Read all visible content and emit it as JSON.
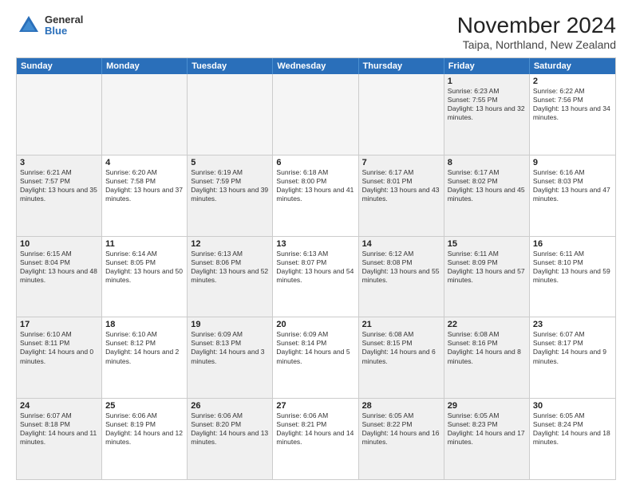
{
  "logo": {
    "general": "General",
    "blue": "Blue"
  },
  "header": {
    "month": "November 2024",
    "location": "Taipa, Northland, New Zealand"
  },
  "weekdays": [
    "Sunday",
    "Monday",
    "Tuesday",
    "Wednesday",
    "Thursday",
    "Friday",
    "Saturday"
  ],
  "rows": [
    [
      {
        "day": "",
        "info": "",
        "empty": true
      },
      {
        "day": "",
        "info": "",
        "empty": true
      },
      {
        "day": "",
        "info": "",
        "empty": true
      },
      {
        "day": "",
        "info": "",
        "empty": true
      },
      {
        "day": "",
        "info": "",
        "empty": true
      },
      {
        "day": "1",
        "info": "Sunrise: 6:23 AM\nSunset: 7:55 PM\nDaylight: 13 hours and 32 minutes.",
        "shaded": true
      },
      {
        "day": "2",
        "info": "Sunrise: 6:22 AM\nSunset: 7:56 PM\nDaylight: 13 hours and 34 minutes.",
        "shaded": false
      }
    ],
    [
      {
        "day": "3",
        "info": "Sunrise: 6:21 AM\nSunset: 7:57 PM\nDaylight: 13 hours and 35 minutes.",
        "shaded": true
      },
      {
        "day": "4",
        "info": "Sunrise: 6:20 AM\nSunset: 7:58 PM\nDaylight: 13 hours and 37 minutes.",
        "shaded": false
      },
      {
        "day": "5",
        "info": "Sunrise: 6:19 AM\nSunset: 7:59 PM\nDaylight: 13 hours and 39 minutes.",
        "shaded": true
      },
      {
        "day": "6",
        "info": "Sunrise: 6:18 AM\nSunset: 8:00 PM\nDaylight: 13 hours and 41 minutes.",
        "shaded": false
      },
      {
        "day": "7",
        "info": "Sunrise: 6:17 AM\nSunset: 8:01 PM\nDaylight: 13 hours and 43 minutes.",
        "shaded": true
      },
      {
        "day": "8",
        "info": "Sunrise: 6:17 AM\nSunset: 8:02 PM\nDaylight: 13 hours and 45 minutes.",
        "shaded": true
      },
      {
        "day": "9",
        "info": "Sunrise: 6:16 AM\nSunset: 8:03 PM\nDaylight: 13 hours and 47 minutes.",
        "shaded": false
      }
    ],
    [
      {
        "day": "10",
        "info": "Sunrise: 6:15 AM\nSunset: 8:04 PM\nDaylight: 13 hours and 48 minutes.",
        "shaded": true
      },
      {
        "day": "11",
        "info": "Sunrise: 6:14 AM\nSunset: 8:05 PM\nDaylight: 13 hours and 50 minutes.",
        "shaded": false
      },
      {
        "day": "12",
        "info": "Sunrise: 6:13 AM\nSunset: 8:06 PM\nDaylight: 13 hours and 52 minutes.",
        "shaded": true
      },
      {
        "day": "13",
        "info": "Sunrise: 6:13 AM\nSunset: 8:07 PM\nDaylight: 13 hours and 54 minutes.",
        "shaded": false
      },
      {
        "day": "14",
        "info": "Sunrise: 6:12 AM\nSunset: 8:08 PM\nDaylight: 13 hours and 55 minutes.",
        "shaded": true
      },
      {
        "day": "15",
        "info": "Sunrise: 6:11 AM\nSunset: 8:09 PM\nDaylight: 13 hours and 57 minutes.",
        "shaded": true
      },
      {
        "day": "16",
        "info": "Sunrise: 6:11 AM\nSunset: 8:10 PM\nDaylight: 13 hours and 59 minutes.",
        "shaded": false
      }
    ],
    [
      {
        "day": "17",
        "info": "Sunrise: 6:10 AM\nSunset: 8:11 PM\nDaylight: 14 hours and 0 minutes.",
        "shaded": true
      },
      {
        "day": "18",
        "info": "Sunrise: 6:10 AM\nSunset: 8:12 PM\nDaylight: 14 hours and 2 minutes.",
        "shaded": false
      },
      {
        "day": "19",
        "info": "Sunrise: 6:09 AM\nSunset: 8:13 PM\nDaylight: 14 hours and 3 minutes.",
        "shaded": true
      },
      {
        "day": "20",
        "info": "Sunrise: 6:09 AM\nSunset: 8:14 PM\nDaylight: 14 hours and 5 minutes.",
        "shaded": false
      },
      {
        "day": "21",
        "info": "Sunrise: 6:08 AM\nSunset: 8:15 PM\nDaylight: 14 hours and 6 minutes.",
        "shaded": true
      },
      {
        "day": "22",
        "info": "Sunrise: 6:08 AM\nSunset: 8:16 PM\nDaylight: 14 hours and 8 minutes.",
        "shaded": true
      },
      {
        "day": "23",
        "info": "Sunrise: 6:07 AM\nSunset: 8:17 PM\nDaylight: 14 hours and 9 minutes.",
        "shaded": false
      }
    ],
    [
      {
        "day": "24",
        "info": "Sunrise: 6:07 AM\nSunset: 8:18 PM\nDaylight: 14 hours and 11 minutes.",
        "shaded": true
      },
      {
        "day": "25",
        "info": "Sunrise: 6:06 AM\nSunset: 8:19 PM\nDaylight: 14 hours and 12 minutes.",
        "shaded": false
      },
      {
        "day": "26",
        "info": "Sunrise: 6:06 AM\nSunset: 8:20 PM\nDaylight: 14 hours and 13 minutes.",
        "shaded": true
      },
      {
        "day": "27",
        "info": "Sunrise: 6:06 AM\nSunset: 8:21 PM\nDaylight: 14 hours and 14 minutes.",
        "shaded": false
      },
      {
        "day": "28",
        "info": "Sunrise: 6:05 AM\nSunset: 8:22 PM\nDaylight: 14 hours and 16 minutes.",
        "shaded": true
      },
      {
        "day": "29",
        "info": "Sunrise: 6:05 AM\nSunset: 8:23 PM\nDaylight: 14 hours and 17 minutes.",
        "shaded": true
      },
      {
        "day": "30",
        "info": "Sunrise: 6:05 AM\nSunset: 8:24 PM\nDaylight: 14 hours and 18 minutes.",
        "shaded": false
      }
    ]
  ]
}
